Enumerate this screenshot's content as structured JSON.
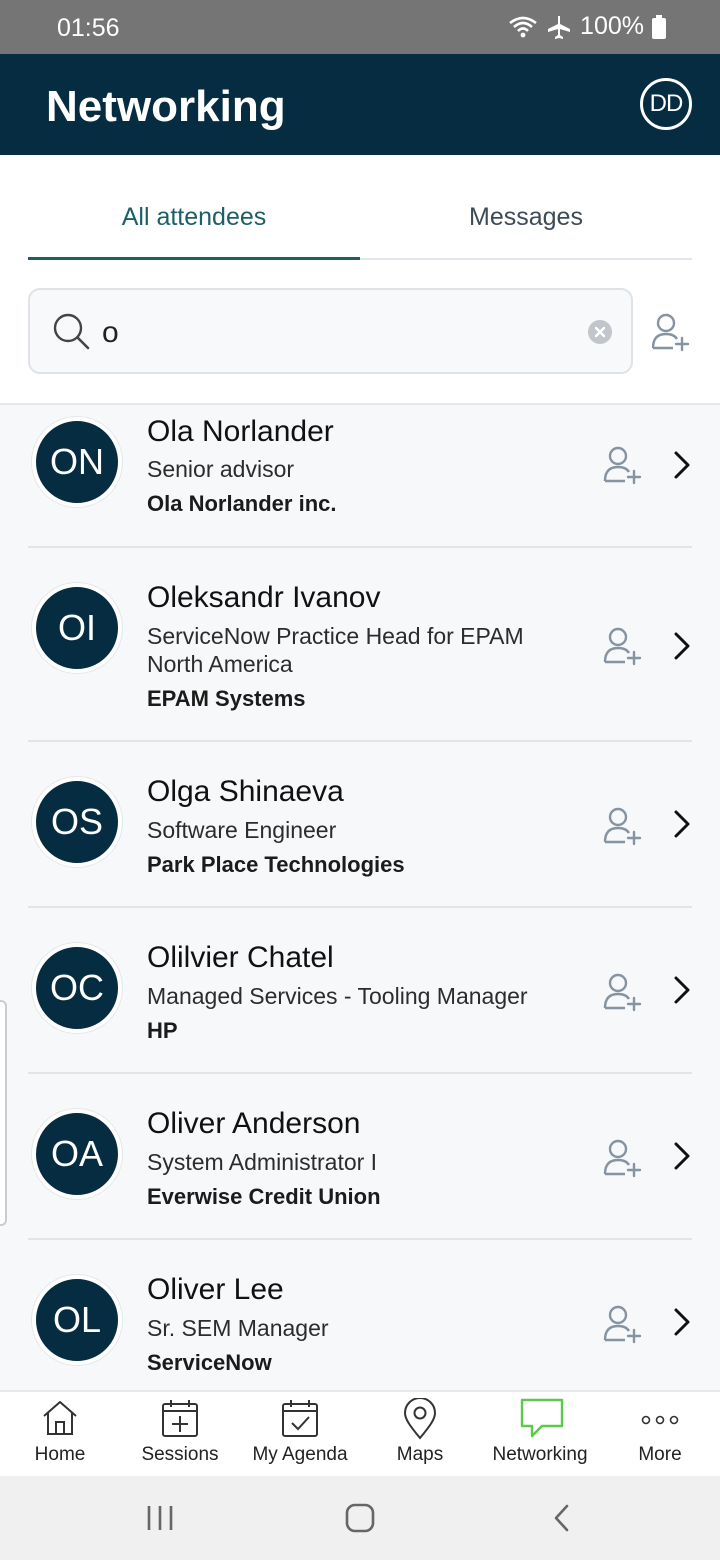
{
  "status_bar": {
    "time": "01:56",
    "battery": "100%"
  },
  "header": {
    "title": "Networking",
    "user_initials": "DD"
  },
  "tabs": [
    {
      "label": "All attendees",
      "active": true
    },
    {
      "label": "Messages",
      "active": false
    }
  ],
  "search": {
    "value": "o"
  },
  "attendees": [
    {
      "initials": "ON",
      "name": "Ola Norlander",
      "title": "Senior advisor",
      "company": "Ola Norlander inc."
    },
    {
      "initials": "OI",
      "name": "Oleksandr Ivanov",
      "title": "ServiceNow Practice Head for EPAM North America",
      "company": "EPAM Systems"
    },
    {
      "initials": "OS",
      "name": "Olga Shinaeva",
      "title": "Software Engineer",
      "company": "Park Place Technologies"
    },
    {
      "initials": "OC",
      "name": "Olilvier Chatel",
      "title": "Managed Services - Tooling Manager",
      "company": "HP"
    },
    {
      "initials": "OA",
      "name": "Oliver Anderson",
      "title": "System Administrator I",
      "company": "Everwise Credit Union"
    },
    {
      "initials": "OL",
      "name": "Oliver Lee",
      "title": "Sr. SEM Manager",
      "company": "ServiceNow"
    }
  ],
  "bottom_nav": [
    {
      "label": "Home",
      "icon": "home-icon",
      "active": false
    },
    {
      "label": "Sessions",
      "icon": "calendar-plus-icon",
      "active": false
    },
    {
      "label": "My Agenda",
      "icon": "calendar-check-icon",
      "active": false
    },
    {
      "label": "Maps",
      "icon": "map-pin-icon",
      "active": false
    },
    {
      "label": "Networking",
      "icon": "chat-bubble-icon",
      "active": true
    },
    {
      "label": "More",
      "icon": "more-dots-icon",
      "active": false
    }
  ],
  "colors": {
    "header_bg": "#062c42",
    "accent": "#1e5f66",
    "active_nav": "#5bc94a"
  }
}
